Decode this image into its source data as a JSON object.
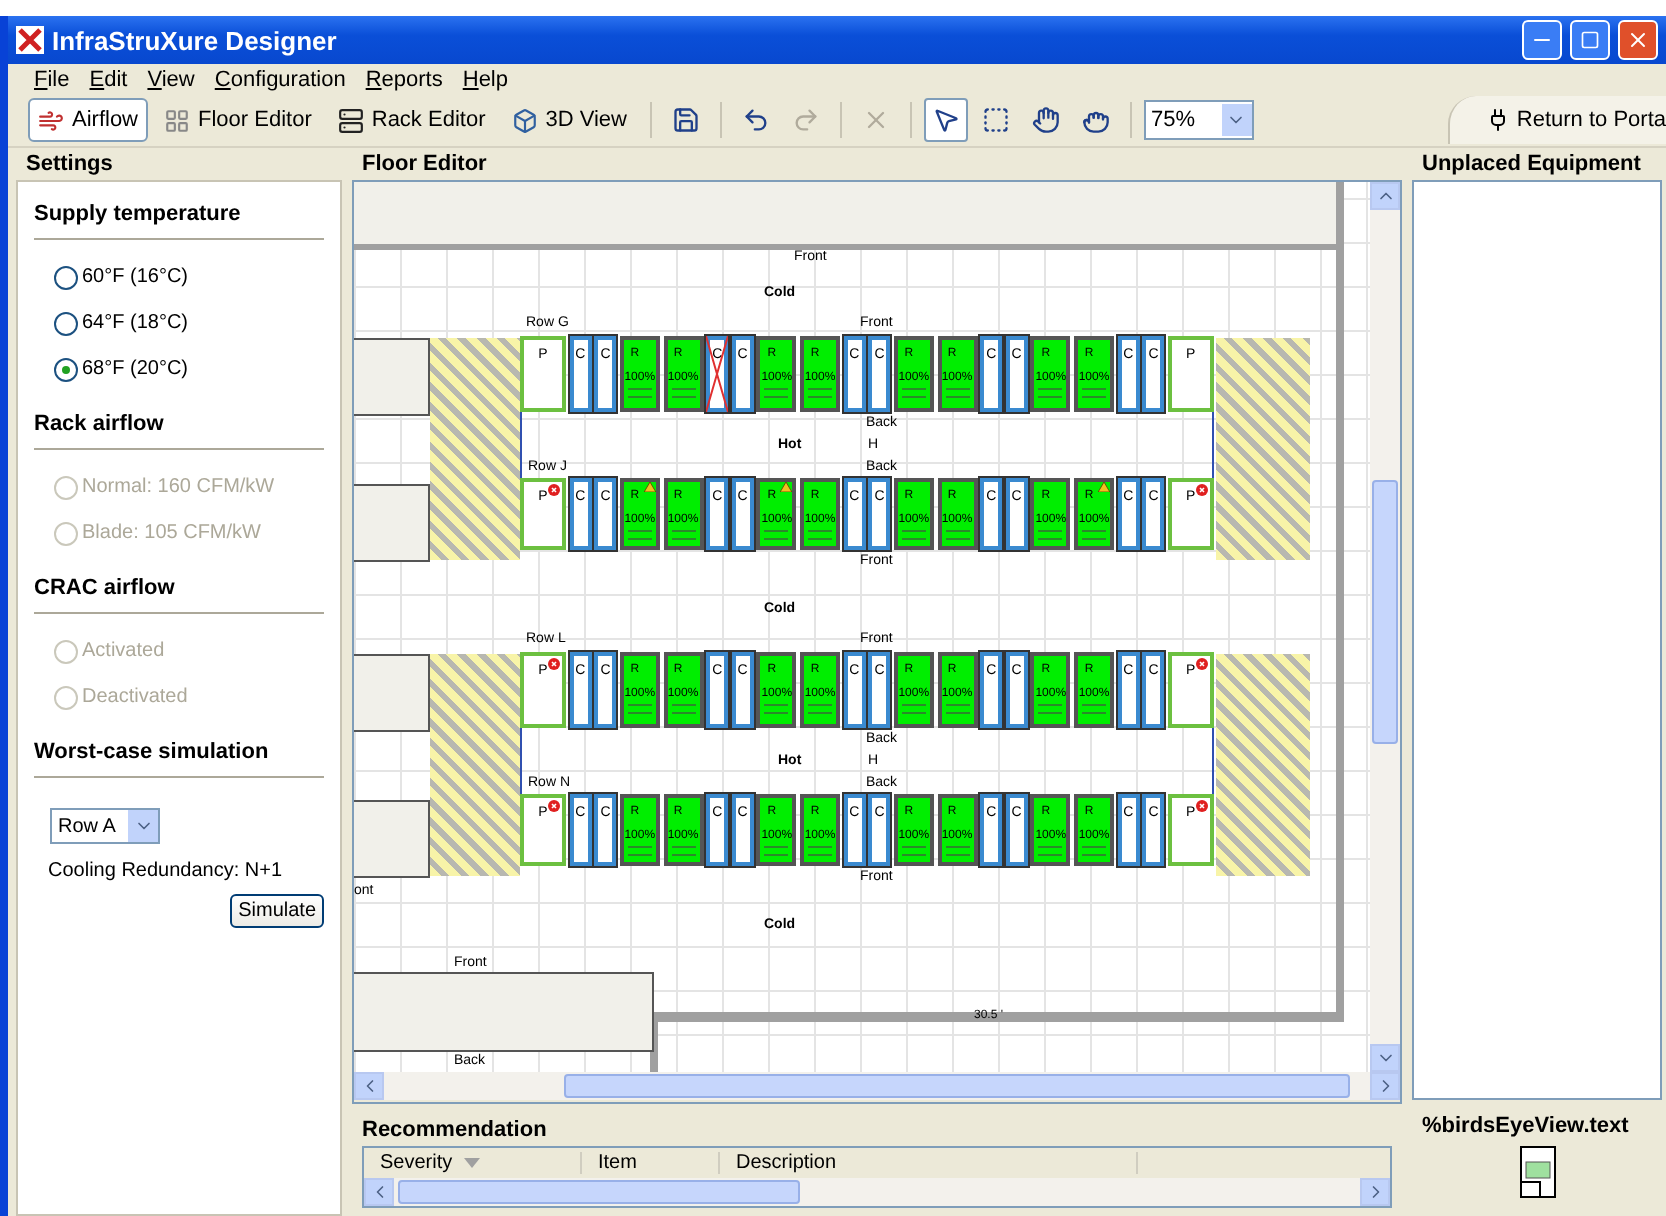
{
  "window": {
    "title": "InfraStruXure Designer"
  },
  "menu": [
    "File",
    "Edit",
    "View",
    "Configuration",
    "Reports",
    "Help"
  ],
  "toolbar": {
    "tabs": [
      {
        "label": "Airflow",
        "kind": "airflow",
        "selected": true
      },
      {
        "label": "Floor Editor",
        "kind": "floor",
        "selected": false
      },
      {
        "label": "Rack Editor",
        "kind": "rack",
        "selected": false
      },
      {
        "label": "3D View",
        "kind": "view3d",
        "selected": false
      }
    ],
    "tools": [
      {
        "kind": "save",
        "disabled": false,
        "selected": false
      },
      {
        "kind": "undo",
        "disabled": false,
        "selected": false
      },
      {
        "kind": "redo",
        "disabled": true,
        "selected": false
      },
      {
        "kind": "delete",
        "disabled": true,
        "selected": false
      },
      {
        "kind": "select",
        "disabled": false,
        "selected": true
      },
      {
        "kind": "marquee",
        "disabled": false,
        "selected": false
      },
      {
        "kind": "pan",
        "disabled": false,
        "selected": false
      },
      {
        "kind": "zoom",
        "disabled": false,
        "selected": false
      }
    ],
    "zoom": "75%",
    "portal": "Return to Porta"
  },
  "settings": {
    "title": "Settings",
    "sections": [
      {
        "title": "Supply temperature",
        "options": [
          {
            "label": "60°F (16°C)",
            "selected": false,
            "disabled": false
          },
          {
            "label": "64°F (18°C)",
            "selected": false,
            "disabled": false
          },
          {
            "label": "68°F (20°C)",
            "selected": true,
            "disabled": false
          }
        ]
      },
      {
        "title": "Rack airflow",
        "options": [
          {
            "label": "Normal: 160 CFM/kW",
            "selected": false,
            "disabled": true
          },
          {
            "label": "Blade: 105 CFM/kW",
            "selected": false,
            "disabled": true
          }
        ]
      },
      {
        "title": "CRAC airflow",
        "options": [
          {
            "label": "Activated",
            "selected": false,
            "disabled": true
          },
          {
            "label": "Deactivated",
            "selected": false,
            "disabled": true
          }
        ]
      }
    ],
    "simulation": {
      "title": "Worst-case simulation",
      "row": "Row A",
      "redundancy": "Cooling Redundancy: N+1",
      "button": "Simulate"
    }
  },
  "floor_editor": {
    "title": "Floor Editor",
    "top_label": "Front",
    "cold_labels": [
      "Cold",
      "Cold",
      "Cold"
    ],
    "edge_label": "ont",
    "block": {
      "front": "Front",
      "back": "Back"
    },
    "dimension": "30.5 '",
    "pods": [
      {
        "front_top": "Front",
        "back_top": "Back",
        "hot": "Hot",
        "hot_mark": "H",
        "back_bottom": "Back",
        "front_bottom": "Front",
        "rows": [
          {
            "label": "Row G",
            "units": [
              {
                "kind": "pdu",
                "text": "P",
                "alarm": false
              },
              {
                "kind": "cooler",
                "text": "C",
                "crossed": false
              },
              {
                "kind": "cooler",
                "text": "C",
                "crossed": false
              },
              {
                "kind": "rack",
                "text": "R",
                "load": "100%",
                "warning": false
              },
              {
                "kind": "rack",
                "text": "R",
                "load": "100%",
                "warning": false
              },
              {
                "kind": "cooler",
                "text": "C",
                "crossed": true
              },
              {
                "kind": "cooler",
                "text": "C",
                "crossed": false
              },
              {
                "kind": "rack",
                "text": "R",
                "load": "100%",
                "warning": false
              },
              {
                "kind": "rack",
                "text": "R",
                "load": "100%",
                "warning": false
              },
              {
                "kind": "cooler",
                "text": "C",
                "crossed": false
              },
              {
                "kind": "cooler",
                "text": "C",
                "crossed": false
              },
              {
                "kind": "rack",
                "text": "R",
                "load": "100%",
                "warning": false
              },
              {
                "kind": "rack",
                "text": "R",
                "load": "100%",
                "warning": false
              },
              {
                "kind": "cooler",
                "text": "C",
                "crossed": false
              },
              {
                "kind": "cooler",
                "text": "C",
                "crossed": false
              },
              {
                "kind": "rack",
                "text": "R",
                "load": "100%",
                "warning": false
              },
              {
                "kind": "rack",
                "text": "R",
                "load": "100%",
                "warning": false
              },
              {
                "kind": "cooler",
                "text": "C",
                "crossed": false
              },
              {
                "kind": "cooler",
                "text": "C",
                "crossed": false
              },
              {
                "kind": "pdu",
                "text": "P",
                "alarm": false
              }
            ]
          },
          {
            "label": "Row J",
            "units": [
              {
                "kind": "pdu",
                "text": "P",
                "alarm": true
              },
              {
                "kind": "cooler",
                "text": "C",
                "crossed": false
              },
              {
                "kind": "cooler",
                "text": "C",
                "crossed": false
              },
              {
                "kind": "rack",
                "text": "R",
                "load": "100%",
                "warning": true
              },
              {
                "kind": "rack",
                "text": "R",
                "load": "100%",
                "warning": false
              },
              {
                "kind": "cooler",
                "text": "C",
                "crossed": false
              },
              {
                "kind": "cooler",
                "text": "C",
                "crossed": false
              },
              {
                "kind": "rack",
                "text": "R",
                "load": "100%",
                "warning": true
              },
              {
                "kind": "rack",
                "text": "R",
                "load": "100%",
                "warning": false
              },
              {
                "kind": "cooler",
                "text": "C",
                "crossed": false
              },
              {
                "kind": "cooler",
                "text": "C",
                "crossed": false
              },
              {
                "kind": "rack",
                "text": "R",
                "load": "100%",
                "warning": false
              },
              {
                "kind": "rack",
                "text": "R",
                "load": "100%",
                "warning": false
              },
              {
                "kind": "cooler",
                "text": "C",
                "crossed": false
              },
              {
                "kind": "cooler",
                "text": "C",
                "crossed": false
              },
              {
                "kind": "rack",
                "text": "R",
                "load": "100%",
                "warning": false
              },
              {
                "kind": "rack",
                "text": "R",
                "load": "100%",
                "warning": true
              },
              {
                "kind": "cooler",
                "text": "C",
                "crossed": false
              },
              {
                "kind": "cooler",
                "text": "C",
                "crossed": false
              },
              {
                "kind": "pdu",
                "text": "P",
                "alarm": true
              }
            ]
          }
        ]
      },
      {
        "front_top": "Front",
        "back_top": "Back",
        "hot": "Hot",
        "hot_mark": "H",
        "back_bottom": "Back",
        "front_bottom": "Front",
        "rows": [
          {
            "label": "Row L",
            "units": [
              {
                "kind": "pdu",
                "text": "P",
                "alarm": true
              },
              {
                "kind": "cooler",
                "text": "C",
                "crossed": false
              },
              {
                "kind": "cooler",
                "text": "C",
                "crossed": false
              },
              {
                "kind": "rack",
                "text": "R",
                "load": "100%",
                "warning": false
              },
              {
                "kind": "rack",
                "text": "R",
                "load": "100%",
                "warning": false
              },
              {
                "kind": "cooler",
                "text": "C",
                "crossed": false
              },
              {
                "kind": "cooler",
                "text": "C",
                "crossed": false
              },
              {
                "kind": "rack",
                "text": "R",
                "load": "100%",
                "warning": false
              },
              {
                "kind": "rack",
                "text": "R",
                "load": "100%",
                "warning": false
              },
              {
                "kind": "cooler",
                "text": "C",
                "crossed": false
              },
              {
                "kind": "cooler",
                "text": "C",
                "crossed": false
              },
              {
                "kind": "rack",
                "text": "R",
                "load": "100%",
                "warning": false
              },
              {
                "kind": "rack",
                "text": "R",
                "load": "100%",
                "warning": false
              },
              {
                "kind": "cooler",
                "text": "C",
                "crossed": false
              },
              {
                "kind": "cooler",
                "text": "C",
                "crossed": false
              },
              {
                "kind": "rack",
                "text": "R",
                "load": "100%",
                "warning": false
              },
              {
                "kind": "rack",
                "text": "R",
                "load": "100%",
                "warning": false
              },
              {
                "kind": "cooler",
                "text": "C",
                "crossed": false
              },
              {
                "kind": "cooler",
                "text": "C",
                "crossed": false
              },
              {
                "kind": "pdu",
                "text": "P",
                "alarm": true
              }
            ]
          },
          {
            "label": "Row N",
            "units": [
              {
                "kind": "pdu",
                "text": "P",
                "alarm": true
              },
              {
                "kind": "cooler",
                "text": "C",
                "crossed": false
              },
              {
                "kind": "cooler",
                "text": "C",
                "crossed": false
              },
              {
                "kind": "rack",
                "text": "R",
                "load": "100%",
                "warning": false
              },
              {
                "kind": "rack",
                "text": "R",
                "load": "100%",
                "warning": false
              },
              {
                "kind": "cooler",
                "text": "C",
                "crossed": false
              },
              {
                "kind": "cooler",
                "text": "C",
                "crossed": false
              },
              {
                "kind": "rack",
                "text": "R",
                "load": "100%",
                "warning": false
              },
              {
                "kind": "rack",
                "text": "R",
                "load": "100%",
                "warning": false
              },
              {
                "kind": "cooler",
                "text": "C",
                "crossed": false
              },
              {
                "kind": "cooler",
                "text": "C",
                "crossed": false
              },
              {
                "kind": "rack",
                "text": "R",
                "load": "100%",
                "warning": false
              },
              {
                "kind": "rack",
                "text": "R",
                "load": "100%",
                "warning": false
              },
              {
                "kind": "cooler",
                "text": "C",
                "crossed": false
              },
              {
                "kind": "cooler",
                "text": "C",
                "crossed": false
              },
              {
                "kind": "rack",
                "text": "R",
                "load": "100%",
                "warning": false
              },
              {
                "kind": "rack",
                "text": "R",
                "load": "100%",
                "warning": false
              },
              {
                "kind": "cooler",
                "text": "C",
                "crossed": false
              },
              {
                "kind": "cooler",
                "text": "C",
                "crossed": false
              },
              {
                "kind": "pdu",
                "text": "P",
                "alarm": true
              }
            ]
          }
        ]
      }
    ]
  },
  "unplaced": {
    "title": "Unplaced Equipment"
  },
  "recommendation": {
    "title": "Recommendation",
    "columns": [
      {
        "label": "Severity",
        "sorted": true
      },
      {
        "label": "Item",
        "sorted": false
      },
      {
        "label": "Description",
        "sorted": false
      }
    ]
  },
  "birds_eye": {
    "title": "%birdsEyeView.text"
  }
}
